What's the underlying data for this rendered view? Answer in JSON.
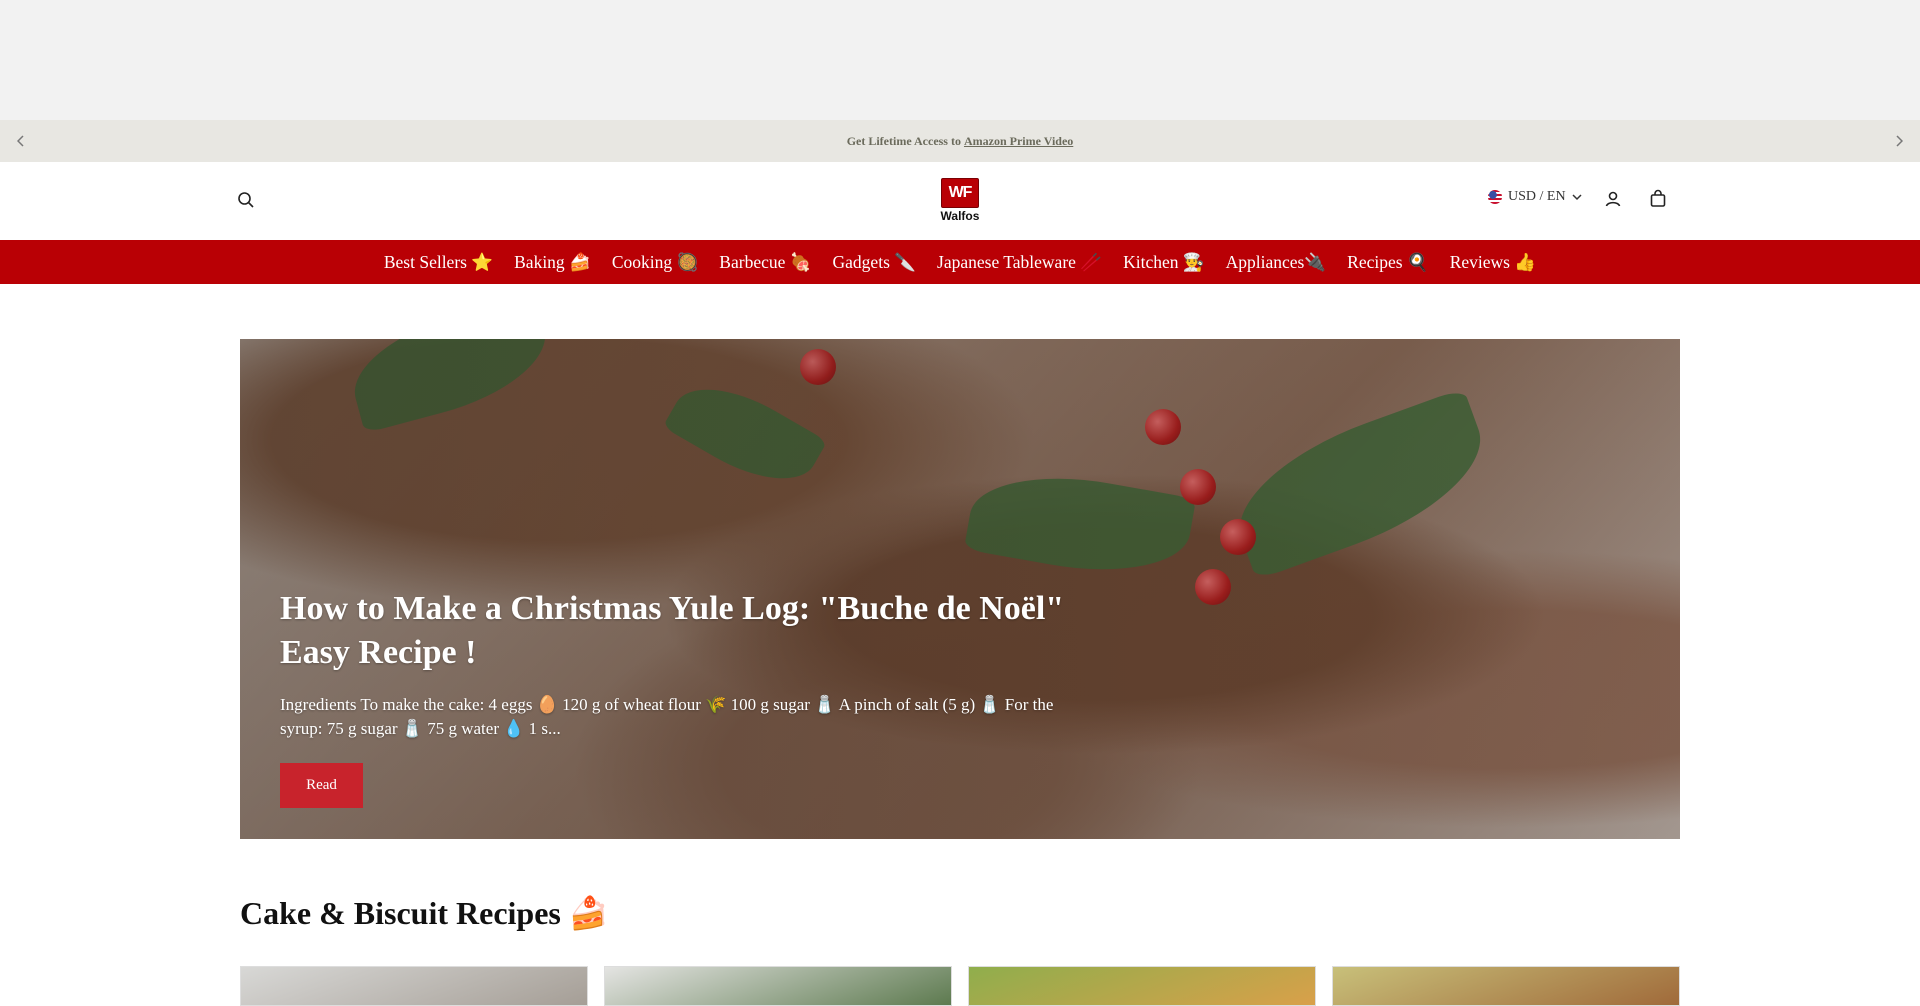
{
  "announcement": {
    "prefix": "Get Lifetime Access to",
    "link_text": "Amazon Prime Video",
    "prev_icon": "chevron-left-icon",
    "next_icon": "chevron-right-icon"
  },
  "header": {
    "logo_mark": "WF",
    "logo_text": "Walfos",
    "locale_label": "USD / EN",
    "icons": [
      "search-icon",
      "user-icon",
      "shopping-bag-icon",
      "chevron-down-icon",
      "us-flag-icon"
    ]
  },
  "nav": {
    "items": [
      {
        "label": "Best Sellers ⭐"
      },
      {
        "label": "Baking 🍰"
      },
      {
        "label": "Cooking 🥘"
      },
      {
        "label": "Barbecue 🍖"
      },
      {
        "label": "Gadgets 🔪"
      },
      {
        "label": "Japanese Tableware 🥢"
      },
      {
        "label": "Kitchen 👨‍🍳"
      },
      {
        "label": "Appliances🔌"
      },
      {
        "label": "Recipes 🍳"
      },
      {
        "label": "Reviews 👍"
      }
    ]
  },
  "hero": {
    "title": "How to Make a Christmas Yule Log: \"Buche de Noël\" Easy Recipe !",
    "excerpt": "Ingredients To make the cake: 4 eggs 🥚 120 g of wheat flour 🌾 100 g sugar 🧂 A pinch of salt (5 g) 🧂 For the syrup: 75 g sugar 🧂 75 g water 💧 1 s...",
    "button_label": "Read"
  },
  "section": {
    "title": "Cake & Biscuit Recipes 🍰"
  },
  "colors": {
    "brand_red": "#b90005",
    "button_red": "#c8232c",
    "announcement_bg": "#e8e7e2"
  }
}
